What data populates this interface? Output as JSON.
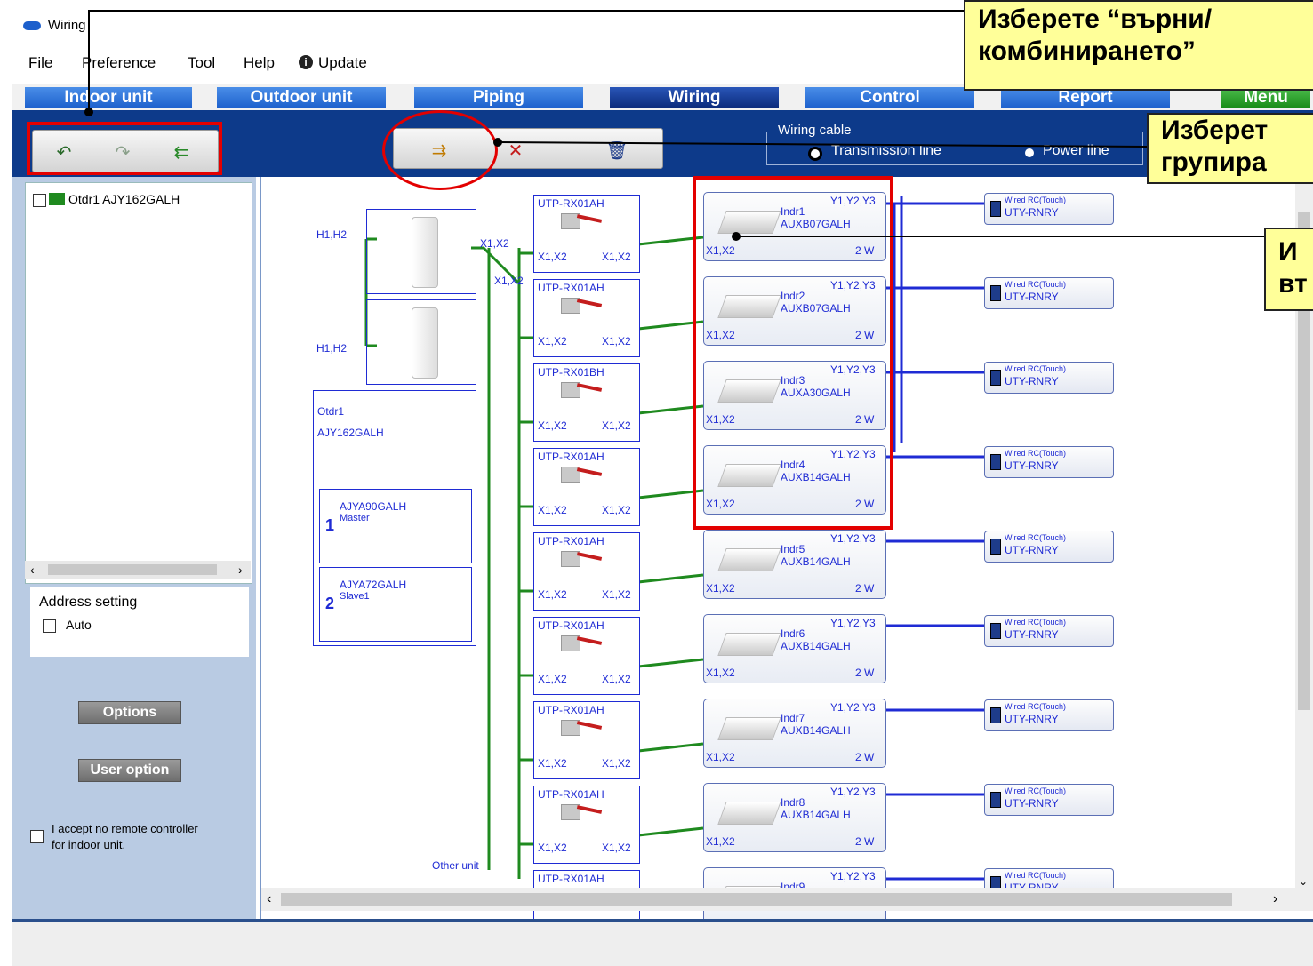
{
  "window": {
    "title": "Wiring"
  },
  "menu": {
    "file": "File",
    "preference": "Preference",
    "tool": "Tool",
    "help": "Help",
    "update": "Update"
  },
  "tabs": {
    "indoor": "Indoor unit",
    "outdoor": "Outdoor unit",
    "piping": "Piping",
    "wiring": "Wiring",
    "control": "Control",
    "report": "Report",
    "menu": "Menu"
  },
  "wiring_cable": {
    "title": "Wiring cable",
    "transmission": "Transmission line",
    "power": "Power line"
  },
  "tree": {
    "item": "Otdr1 AJY162GALH"
  },
  "sidebar": {
    "address_setting": "Address setting",
    "auto": "Auto",
    "options": "Options",
    "user_option": "User option",
    "accept_line1": "I accept no remote controller",
    "accept_line2": "for indoor unit."
  },
  "diagram": {
    "h1h2": "H1,H2",
    "x1x2": "X1,X2",
    "otdr_name": "Otdr1",
    "otdr_model": "AJY162GALH",
    "master": {
      "num": "1",
      "model": "AJYA90GALH",
      "role": "Master"
    },
    "slave": {
      "num": "2",
      "model": "AJYA72GALH",
      "role": "Slave1"
    },
    "other_unit": "Other unit",
    "y1y2y3": "Y1,Y2,Y3",
    "power_2w": "2 W",
    "rc_type": "Wired RC(Touch)",
    "rc_model": "UTY-RNRY",
    "utp": [
      "UTP-RX01AH",
      "UTP-RX01AH",
      "UTP-RX01BH",
      "UTP-RX01AH",
      "UTP-RX01AH",
      "UTP-RX01AH",
      "UTP-RX01AH",
      "UTP-RX01AH",
      "UTP-RX01AH"
    ],
    "indoor": [
      {
        "name": "Indr1",
        "model": "AUXB07GALH"
      },
      {
        "name": "Indr2",
        "model": "AUXB07GALH"
      },
      {
        "name": "Indr3",
        "model": "AUXA30GALH"
      },
      {
        "name": "Indr4",
        "model": "AUXB14GALH"
      },
      {
        "name": "Indr5",
        "model": "AUXB14GALH"
      },
      {
        "name": "Indr6",
        "model": "AUXB14GALH"
      },
      {
        "name": "Indr7",
        "model": "AUXB14GALH"
      },
      {
        "name": "Indr8",
        "model": "AUXB14GALH"
      },
      {
        "name": "Indr9",
        "model": ""
      }
    ]
  },
  "callouts": {
    "c1_line1": "Изберете “върни/",
    "c1_line2": "комбинирането”",
    "c2_line1": "Изберет",
    "c2_line2": "групира",
    "c3_line1": "И",
    "c3_line2": "вт"
  },
  "colors": {
    "accent": "#1c5fcc",
    "toolbar": "#0d3a8a",
    "callout": "#ffff99",
    "highlight": "#e30000",
    "wire_green": "#1f8a1f",
    "wire_blue": "#1f2bd4"
  }
}
